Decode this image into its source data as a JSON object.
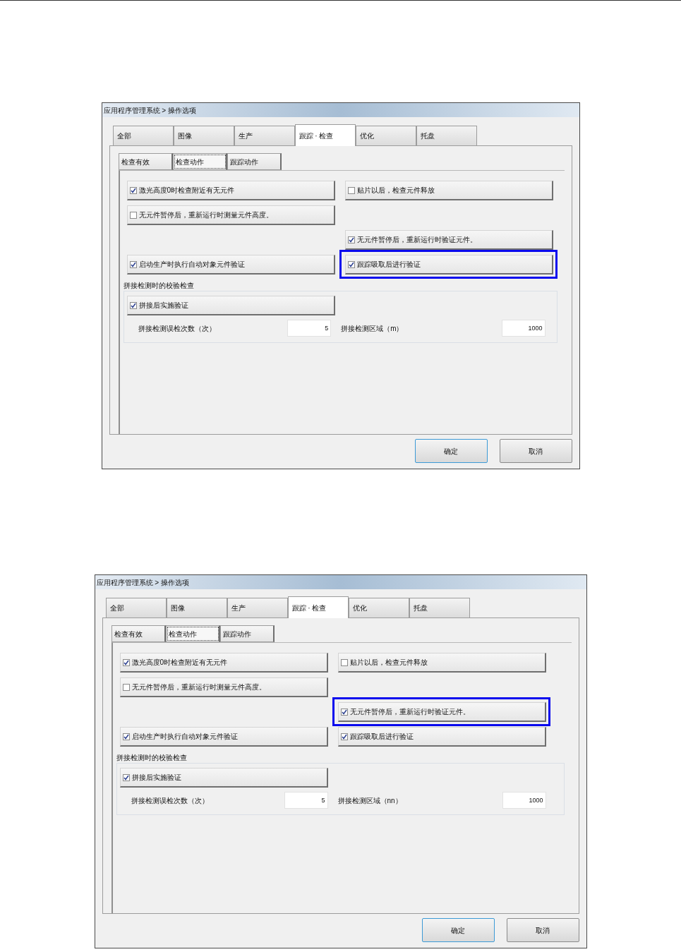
{
  "dialogs": [
    {
      "title": "应用程序管理系统 > 操作选项",
      "tabs": [
        {
          "label": "全部",
          "selected": false
        },
        {
          "label": "图像",
          "selected": false
        },
        {
          "label": "生产",
          "selected": false
        },
        {
          "label": "跟踪 · 检查",
          "selected": true
        },
        {
          "label": "优化",
          "selected": false
        },
        {
          "label": "托盘",
          "selected": false
        }
      ],
      "subtabs": [
        {
          "label": "检查有效",
          "selected": false
        },
        {
          "label": "检查动作",
          "selected": true
        },
        {
          "label": "跟踪动作",
          "selected": false
        }
      ],
      "options": [
        {
          "label": "激光高度0时检查附近有无元件",
          "checked": true,
          "highlighted": false
        },
        {
          "label": "贴片以后，检查元件释放",
          "checked": false,
          "highlighted": false
        },
        {
          "label": "无元件暂停后，重新运行时测量元件高度。",
          "checked": false,
          "highlighted": false
        },
        {
          "label": "无元件暂停后，重新运行时验证元件。",
          "checked": true,
          "highlighted": false
        },
        {
          "label": "启动生产时执行自动对象元件验证",
          "checked": true,
          "highlighted": false
        },
        {
          "label": "跟踪吸取后进行验证",
          "checked": true,
          "highlighted": true
        }
      ],
      "group": {
        "title": "拼接检测时的校验检查",
        "option": {
          "label": "拼接后实施验证",
          "checked": true
        },
        "fields": [
          {
            "label": "拼接检测误检次数（次）",
            "value": "5"
          },
          {
            "label": "拼接检测区域（m）",
            "value": "1000"
          }
        ]
      },
      "buttons": [
        "确定",
        "取消"
      ]
    },
    {
      "title": "应用程序管理系统 > 操作选项",
      "tabs": [
        {
          "label": "全部",
          "selected": false
        },
        {
          "label": "图像",
          "selected": false
        },
        {
          "label": "生产",
          "selected": false
        },
        {
          "label": "跟踪 · 检查",
          "selected": true
        },
        {
          "label": "优化",
          "selected": false
        },
        {
          "label": "托盘",
          "selected": false
        }
      ],
      "subtabs": [
        {
          "label": "检查有效",
          "selected": false
        },
        {
          "label": "检查动作",
          "selected": true
        },
        {
          "label": "跟踪动作",
          "selected": false
        }
      ],
      "options": [
        {
          "label": "激光高度0时检查附近有无元件",
          "checked": true,
          "highlighted": false
        },
        {
          "label": "贴片以后，检查元件释放",
          "checked": false,
          "highlighted": false
        },
        {
          "label": "无元件暂停后，重新运行时测量元件高度。",
          "checked": false,
          "highlighted": false
        },
        {
          "label": "无元件暂停后，重新运行时验证元件。",
          "checked": true,
          "highlighted": true
        },
        {
          "label": "启动生产时执行自动对象元件验证",
          "checked": true,
          "highlighted": false
        },
        {
          "label": "跟踪吸取后进行验证",
          "checked": true,
          "highlighted": false
        }
      ],
      "group": {
        "title": "拼接检测时的校验检查",
        "option": {
          "label": "拼接后实施验证",
          "checked": true
        },
        "fields": [
          {
            "label": "拼接检测误检次数（次）",
            "value": "5"
          },
          {
            "label": "拼接检测区域（nn）",
            "value": "1000"
          }
        ]
      },
      "buttons": [
        "确定",
        "取消"
      ]
    }
  ]
}
